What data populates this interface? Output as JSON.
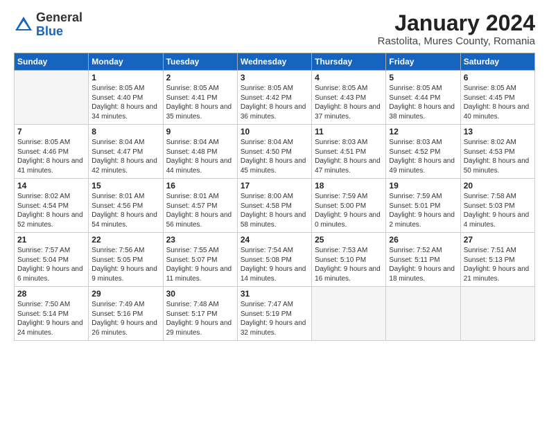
{
  "header": {
    "logo_general": "General",
    "logo_blue": "Blue",
    "month_title": "January 2024",
    "location": "Rastolita, Mures County, Romania"
  },
  "days_of_week": [
    "Sunday",
    "Monday",
    "Tuesday",
    "Wednesday",
    "Thursday",
    "Friday",
    "Saturday"
  ],
  "weeks": [
    [
      {
        "day": "",
        "empty": true
      },
      {
        "day": "1",
        "sunrise": "Sunrise: 8:05 AM",
        "sunset": "Sunset: 4:40 PM",
        "daylight": "Daylight: 8 hours and 34 minutes."
      },
      {
        "day": "2",
        "sunrise": "Sunrise: 8:05 AM",
        "sunset": "Sunset: 4:41 PM",
        "daylight": "Daylight: 8 hours and 35 minutes."
      },
      {
        "day": "3",
        "sunrise": "Sunrise: 8:05 AM",
        "sunset": "Sunset: 4:42 PM",
        "daylight": "Daylight: 8 hours and 36 minutes."
      },
      {
        "day": "4",
        "sunrise": "Sunrise: 8:05 AM",
        "sunset": "Sunset: 4:43 PM",
        "daylight": "Daylight: 8 hours and 37 minutes."
      },
      {
        "day": "5",
        "sunrise": "Sunrise: 8:05 AM",
        "sunset": "Sunset: 4:44 PM",
        "daylight": "Daylight: 8 hours and 38 minutes."
      },
      {
        "day": "6",
        "sunrise": "Sunrise: 8:05 AM",
        "sunset": "Sunset: 4:45 PM",
        "daylight": "Daylight: 8 hours and 40 minutes."
      }
    ],
    [
      {
        "day": "7",
        "sunrise": "Sunrise: 8:05 AM",
        "sunset": "Sunset: 4:46 PM",
        "daylight": "Daylight: 8 hours and 41 minutes."
      },
      {
        "day": "8",
        "sunrise": "Sunrise: 8:04 AM",
        "sunset": "Sunset: 4:47 PM",
        "daylight": "Daylight: 8 hours and 42 minutes."
      },
      {
        "day": "9",
        "sunrise": "Sunrise: 8:04 AM",
        "sunset": "Sunset: 4:48 PM",
        "daylight": "Daylight: 8 hours and 44 minutes."
      },
      {
        "day": "10",
        "sunrise": "Sunrise: 8:04 AM",
        "sunset": "Sunset: 4:50 PM",
        "daylight": "Daylight: 8 hours and 45 minutes."
      },
      {
        "day": "11",
        "sunrise": "Sunrise: 8:03 AM",
        "sunset": "Sunset: 4:51 PM",
        "daylight": "Daylight: 8 hours and 47 minutes."
      },
      {
        "day": "12",
        "sunrise": "Sunrise: 8:03 AM",
        "sunset": "Sunset: 4:52 PM",
        "daylight": "Daylight: 8 hours and 49 minutes."
      },
      {
        "day": "13",
        "sunrise": "Sunrise: 8:02 AM",
        "sunset": "Sunset: 4:53 PM",
        "daylight": "Daylight: 8 hours and 50 minutes."
      }
    ],
    [
      {
        "day": "14",
        "sunrise": "Sunrise: 8:02 AM",
        "sunset": "Sunset: 4:54 PM",
        "daylight": "Daylight: 8 hours and 52 minutes."
      },
      {
        "day": "15",
        "sunrise": "Sunrise: 8:01 AM",
        "sunset": "Sunset: 4:56 PM",
        "daylight": "Daylight: 8 hours and 54 minutes."
      },
      {
        "day": "16",
        "sunrise": "Sunrise: 8:01 AM",
        "sunset": "Sunset: 4:57 PM",
        "daylight": "Daylight: 8 hours and 56 minutes."
      },
      {
        "day": "17",
        "sunrise": "Sunrise: 8:00 AM",
        "sunset": "Sunset: 4:58 PM",
        "daylight": "Daylight: 8 hours and 58 minutes."
      },
      {
        "day": "18",
        "sunrise": "Sunrise: 7:59 AM",
        "sunset": "Sunset: 5:00 PM",
        "daylight": "Daylight: 9 hours and 0 minutes."
      },
      {
        "day": "19",
        "sunrise": "Sunrise: 7:59 AM",
        "sunset": "Sunset: 5:01 PM",
        "daylight": "Daylight: 9 hours and 2 minutes."
      },
      {
        "day": "20",
        "sunrise": "Sunrise: 7:58 AM",
        "sunset": "Sunset: 5:03 PM",
        "daylight": "Daylight: 9 hours and 4 minutes."
      }
    ],
    [
      {
        "day": "21",
        "sunrise": "Sunrise: 7:57 AM",
        "sunset": "Sunset: 5:04 PM",
        "daylight": "Daylight: 9 hours and 6 minutes."
      },
      {
        "day": "22",
        "sunrise": "Sunrise: 7:56 AM",
        "sunset": "Sunset: 5:05 PM",
        "daylight": "Daylight: 9 hours and 9 minutes."
      },
      {
        "day": "23",
        "sunrise": "Sunrise: 7:55 AM",
        "sunset": "Sunset: 5:07 PM",
        "daylight": "Daylight: 9 hours and 11 minutes."
      },
      {
        "day": "24",
        "sunrise": "Sunrise: 7:54 AM",
        "sunset": "Sunset: 5:08 PM",
        "daylight": "Daylight: 9 hours and 14 minutes."
      },
      {
        "day": "25",
        "sunrise": "Sunrise: 7:53 AM",
        "sunset": "Sunset: 5:10 PM",
        "daylight": "Daylight: 9 hours and 16 minutes."
      },
      {
        "day": "26",
        "sunrise": "Sunrise: 7:52 AM",
        "sunset": "Sunset: 5:11 PM",
        "daylight": "Daylight: 9 hours and 18 minutes."
      },
      {
        "day": "27",
        "sunrise": "Sunrise: 7:51 AM",
        "sunset": "Sunset: 5:13 PM",
        "daylight": "Daylight: 9 hours and 21 minutes."
      }
    ],
    [
      {
        "day": "28",
        "sunrise": "Sunrise: 7:50 AM",
        "sunset": "Sunset: 5:14 PM",
        "daylight": "Daylight: 9 hours and 24 minutes."
      },
      {
        "day": "29",
        "sunrise": "Sunrise: 7:49 AM",
        "sunset": "Sunset: 5:16 PM",
        "daylight": "Daylight: 9 hours and 26 minutes."
      },
      {
        "day": "30",
        "sunrise": "Sunrise: 7:48 AM",
        "sunset": "Sunset: 5:17 PM",
        "daylight": "Daylight: 9 hours and 29 minutes."
      },
      {
        "day": "31",
        "sunrise": "Sunrise: 7:47 AM",
        "sunset": "Sunset: 5:19 PM",
        "daylight": "Daylight: 9 hours and 32 minutes."
      },
      {
        "day": "",
        "empty": true
      },
      {
        "day": "",
        "empty": true
      },
      {
        "day": "",
        "empty": true
      }
    ]
  ]
}
